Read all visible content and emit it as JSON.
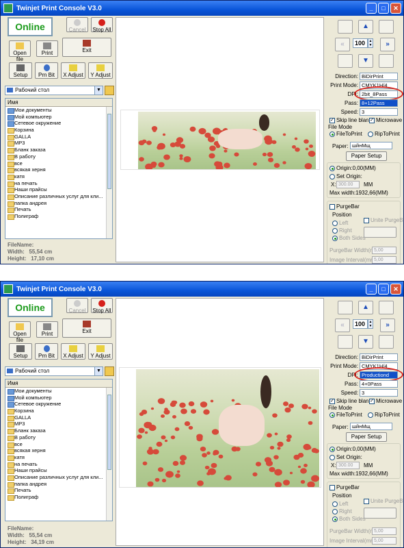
{
  "app_title": "Twinjet Print Console V3.0",
  "window_controls": {
    "minimize": "_",
    "maximize": "□",
    "close": "✕"
  },
  "toolbar": {
    "status": "Online",
    "cancel": "Cancel",
    "stop_all": "Stop All",
    "open_file": "Open file",
    "print": "Print",
    "exit": "Exit",
    "setup": "Setup",
    "prn_bit": "Prn Bit",
    "x_adjust": "X Adjust",
    "y_adjust": "Y Adjust"
  },
  "browser": {
    "drive": "Рабочий стол",
    "column": "Имя",
    "items": [
      "Мои документы",
      "Мой компьютер",
      "Сетевое окружение",
      "Корзина",
      "GALLA",
      "MP3",
      "Бланк заказа",
      "В работу",
      "все",
      "всякая херня",
      "катя",
      "на печать",
      "Наши прайсы",
      "Описание различных услуг для кли...",
      "папка андрея",
      "Печать",
      "Полиграф"
    ],
    "file_name_label": "FileName:",
    "width_label": "Width:",
    "height_label": "Height:"
  },
  "windows": [
    {
      "width_value": "55,54 cm",
      "height_value": "17,10 cm",
      "dpi": "2bit_8Pass",
      "pass": "8+12Pass",
      "pass_highlight": true
    },
    {
      "width_value": "55,54 cm",
      "height_value": "34,19 cm",
      "dpi": "Productiond",
      "pass": "4+0Pass",
      "pass_highlight": false
    }
  ],
  "panel": {
    "step": "100",
    "arrows": {
      "up": "▲",
      "down": "▼",
      "left": "«",
      "right": "»"
    },
    "direction_label": "Direction:",
    "direction": "BiDirPrint",
    "print_mode_label": "Print Mode:",
    "print_mode": "CMYK1H/4",
    "dpi_label": "DPI:",
    "pass_label": "Pass:",
    "speed_label": "Speed:",
    "speed": "3",
    "skip_blank": "Skip line blank",
    "microwave": "Microwave",
    "file_mode_label": "File Mode",
    "file_to_print": "FileToPrint",
    "rip_to_print": "RipToPrint",
    "paper_label": "Paper:",
    "paper": "шйнМщ",
    "paper_setup": "Paper Setup",
    "origin": "Origin:0,00(MM)",
    "set_origin": "Set Origin:",
    "x_label": "X:",
    "x_value": "300.00",
    "mm": "MM",
    "max_width": "Max width:1932,66(MM)",
    "purge_bar": "PurgeBar",
    "position_label": "Position",
    "pos_left": "Left",
    "pos_right": "Right",
    "pos_both": "Both Sides",
    "unite_purge": "Unite PurgeBar",
    "purge_width_label": "PurgeBar Width(mm)",
    "purge_width": "5,00",
    "image_interval_label": "Image Interval(mm)",
    "image_interval": "5,00"
  }
}
